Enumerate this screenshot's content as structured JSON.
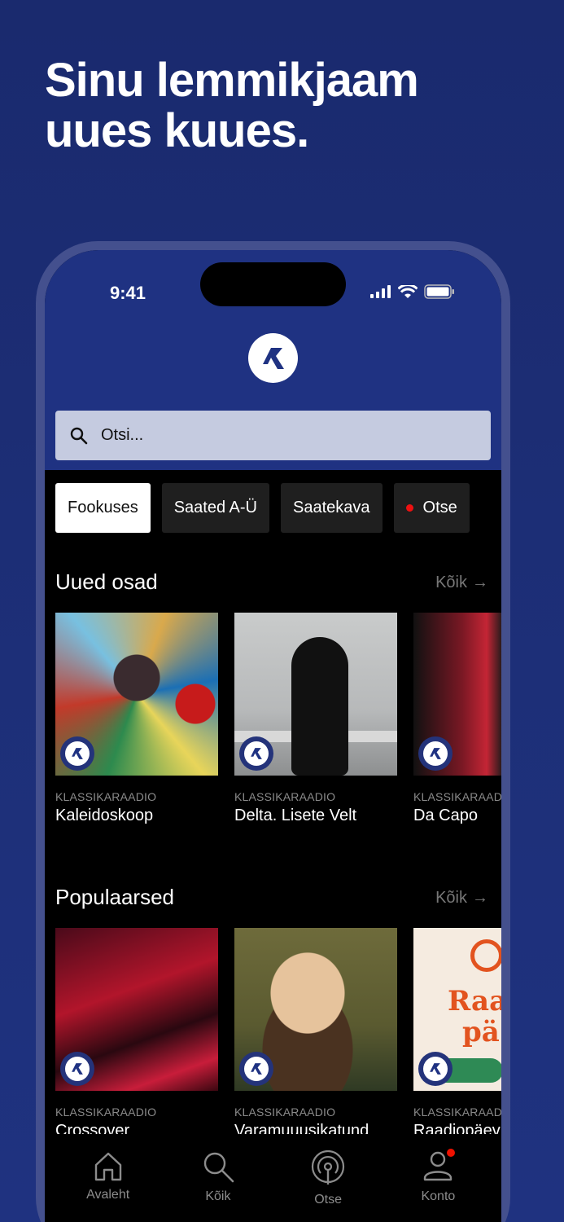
{
  "headline": {
    "line1": "Sinu lemmikjaam",
    "line2": "uues kuues."
  },
  "status_bar": {
    "time": "9:41"
  },
  "search": {
    "placeholder": "Otsi..."
  },
  "chips": [
    {
      "label": "Fookuses",
      "active": true
    },
    {
      "label": "Saated A-Ü",
      "active": false
    },
    {
      "label": "Saatekava",
      "active": false
    },
    {
      "label": "Otse",
      "active": false,
      "live": true
    }
  ],
  "sections": [
    {
      "title": "Uued osad",
      "see_all": "Kõik",
      "cards": [
        {
          "source": "KLASSIKARAADIO",
          "title": "Kaleidoskoop"
        },
        {
          "source": "KLASSIKARAADIO",
          "title": "Delta. Lisete Velt"
        },
        {
          "source": "KLASSIKARAADIO",
          "title": "Da Capo"
        }
      ]
    },
    {
      "title": "Populaarsed",
      "see_all": "Kõik",
      "cards": [
        {
          "source": "KLASSIKARAADIO",
          "title": "Crossover"
        },
        {
          "source": "KLASSIKARAADIO",
          "title": "Varamuuusikatund"
        },
        {
          "source": "KLASSIKARAADIO",
          "title": "Raadiopäev",
          "art_text": [
            "Raa",
            "pä"
          ]
        }
      ]
    }
  ],
  "tabs": [
    {
      "label": "Avaleht",
      "icon": "home-icon"
    },
    {
      "label": "Kõik",
      "icon": "search-icon"
    },
    {
      "label": "Otse",
      "icon": "broadcast-icon"
    },
    {
      "label": "Konto",
      "icon": "account-icon",
      "notification": true
    }
  ],
  "colors": {
    "brand_blue": "#1f3282",
    "live_red": "#e11111"
  }
}
